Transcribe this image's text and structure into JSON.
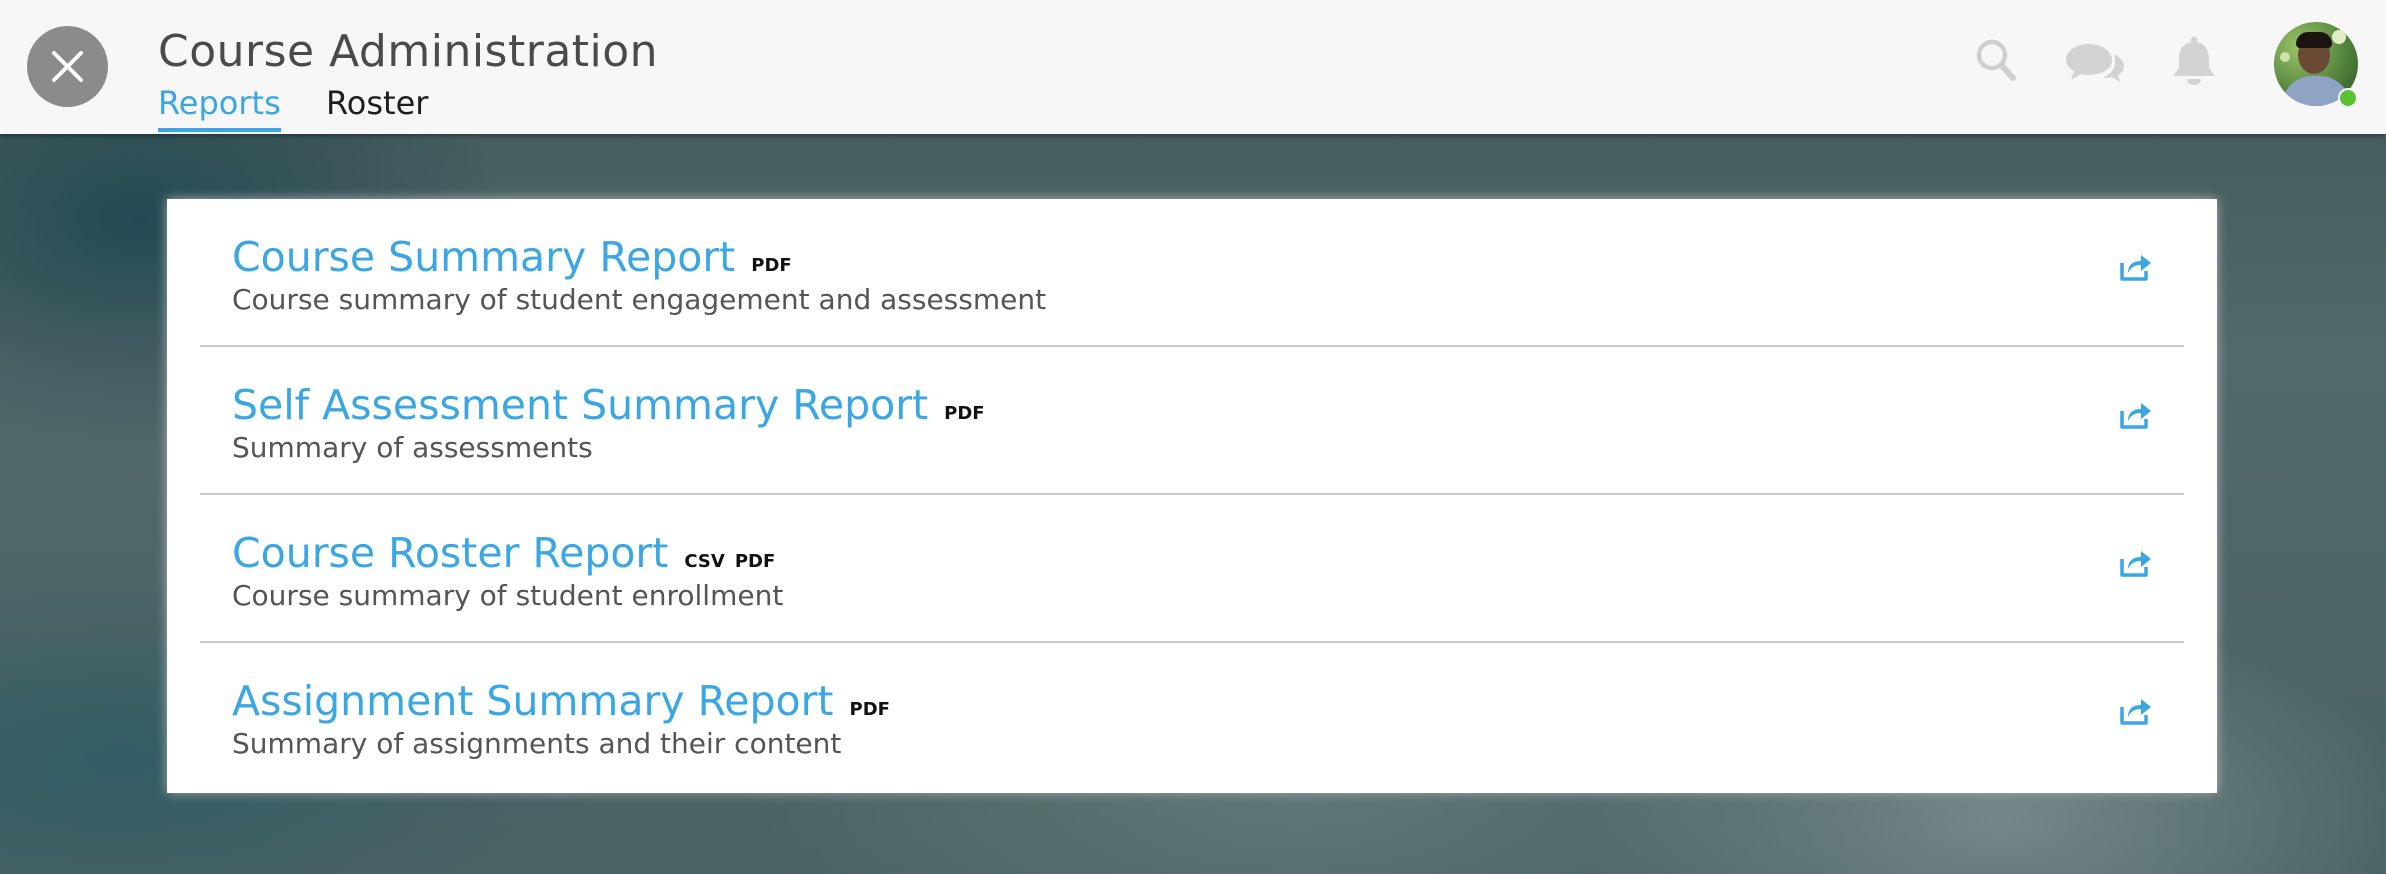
{
  "header": {
    "title": "Course Administration",
    "tabs": [
      {
        "label": "Reports",
        "active": true
      },
      {
        "label": "Roster",
        "active": false
      }
    ],
    "icons": [
      "close-icon",
      "search-icon",
      "chat-icon",
      "bell-icon",
      "avatar"
    ]
  },
  "colors": {
    "accent": "#3aa6e3",
    "header_bg": "#f7f7f7",
    "online_status": "#5bc236"
  },
  "reports": [
    {
      "title": "Course Summary Report",
      "formats": [
        "PDF"
      ],
      "description": "Course summary of student engagement and assessment"
    },
    {
      "title": "Self Assessment Summary Report",
      "formats": [
        "PDF"
      ],
      "description": "Summary of assessments"
    },
    {
      "title": "Course Roster Report",
      "formats": [
        "CSV",
        "PDF"
      ],
      "description": "Course summary of student enrollment"
    },
    {
      "title": "Assignment Summary Report",
      "formats": [
        "PDF"
      ],
      "description": "Summary of assignments and their content"
    }
  ]
}
